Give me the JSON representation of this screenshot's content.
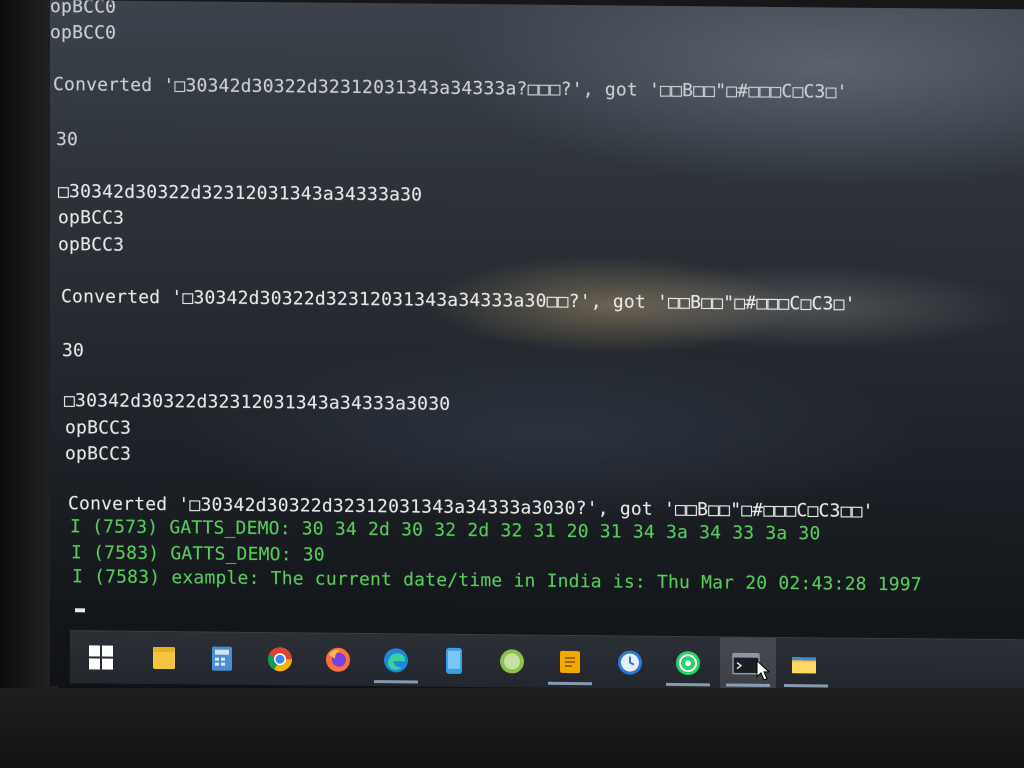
{
  "terminal": {
    "lines": [
      {
        "text": "opBCC0"
      },
      {
        "text": "opBCC0"
      },
      {
        "text": "Converted '□30342d30322d32312031343a34333a?□□□?', got '□□B□□\"□#□□□C□C3□'"
      },
      {
        "text": "30"
      },
      {
        "text": "□30342d30322d32312031343a34333a30"
      },
      {
        "text": "opBCC3"
      },
      {
        "text": "opBCC3"
      },
      {
        "text": "Converted '□30342d30322d32312031343a34333a30□□?', got '□□B□□\"□#□□□C□C3□'"
      },
      {
        "text": "30"
      },
      {
        "text": "□30342d30322d32312031343a34333a3030"
      },
      {
        "text": "opBCC3"
      },
      {
        "text": "opBCC3"
      },
      {
        "text": "Converted '□30342d30322d32312031343a34333a3030?', got '□□B□□\"□#□□□C□C3□□'"
      },
      {
        "text": "I (7573) GATTS_DEMO: 30 34 2d 30 32 2d 32 31 20 31 34 3a 34 33 3a 30"
      },
      {
        "text": "I (7583) GATTS_DEMO: 30"
      },
      {
        "text": "I (7583) example: The current date/time in India is: Thu Mar 20 02:43:28 1997"
      }
    ],
    "colors": {
      "text": "#e6e6e6",
      "log": "#58c95d",
      "background": "#262b31"
    }
  },
  "taskbar": {
    "icons": [
      {
        "name": "windows-start-icon"
      },
      {
        "name": "sticky-notes-icon"
      },
      {
        "name": "calculator-icon"
      },
      {
        "name": "chrome-icon"
      },
      {
        "name": "firefox-icon"
      },
      {
        "name": "edge-icon"
      },
      {
        "name": "phone-app-icon"
      },
      {
        "name": "globe-app-icon"
      },
      {
        "name": "notes-app-icon"
      },
      {
        "name": "clock-app-icon"
      },
      {
        "name": "whatsapp-icon"
      },
      {
        "name": "terminal-icon"
      },
      {
        "name": "file-explorer-icon"
      }
    ]
  }
}
